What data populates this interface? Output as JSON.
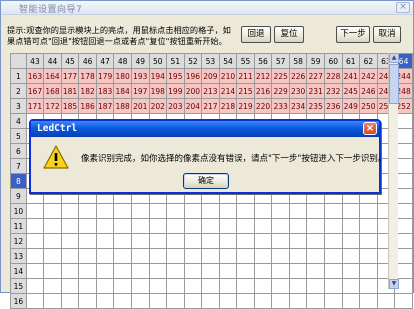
{
  "window": {
    "title": "智能设置向导7",
    "close_glyph": "×"
  },
  "hint_text": "提示:观查你的显示模块上的亮点，用鼠标点击相应的格子，如果点错可点\"回退\"按钮回退一点或者点\"复位\"按钮重新开始。",
  "buttons": {
    "back": "回退",
    "reset": "复位",
    "next": "下一步",
    "cancel": "取消"
  },
  "grid": {
    "columns": [
      "43",
      "44",
      "45",
      "46",
      "47",
      "48",
      "49",
      "50",
      "51",
      "52",
      "53",
      "54",
      "55",
      "56",
      "57",
      "58",
      "59",
      "60",
      "61",
      "62",
      "63",
      "64"
    ],
    "rows": [
      {
        "label": "1",
        "cells": [
          "163",
          "164",
          "177",
          "178",
          "179",
          "180",
          "193",
          "194",
          "195",
          "196",
          "209",
          "210",
          "211",
          "212",
          "225",
          "226",
          "227",
          "228",
          "241",
          "242",
          "243",
          "244"
        ]
      },
      {
        "label": "2",
        "cells": [
          "167",
          "168",
          "181",
          "182",
          "183",
          "184",
          "197",
          "198",
          "199",
          "200",
          "213",
          "214",
          "215",
          "216",
          "229",
          "230",
          "231",
          "232",
          "245",
          "246",
          "247",
          "248"
        ]
      },
      {
        "label": "3",
        "cells": [
          "171",
          "172",
          "185",
          "186",
          "187",
          "188",
          "201",
          "202",
          "203",
          "204",
          "217",
          "218",
          "219",
          "220",
          "233",
          "234",
          "235",
          "236",
          "249",
          "250",
          "251",
          "252"
        ]
      },
      {
        "label": "4",
        "cells": [
          "",
          "",
          "",
          "",
          "",
          "",
          "",
          "",
          "",
          "",
          "",
          "",
          "",
          "",
          "",
          "",
          "",
          "",
          "",
          "",
          "",
          ""
        ]
      },
      {
        "label": "5",
        "cells": [
          "",
          "",
          "",
          "",
          "",
          "",
          "",
          "",
          "",
          "",
          "",
          "",
          "",
          "",
          "",
          "",
          "",
          "",
          "",
          "",
          "",
          ""
        ]
      },
      {
        "label": "6",
        "cells": [
          "",
          "",
          "",
          "",
          "",
          "",
          "",
          "",
          "",
          "",
          "",
          "",
          "",
          "",
          "",
          "",
          "",
          "",
          "",
          "",
          "",
          ""
        ]
      },
      {
        "label": "7",
        "cells": [
          "",
          "",
          "",
          "",
          "",
          "",
          "",
          "",
          "",
          "",
          "",
          "",
          "",
          "",
          "",
          "",
          "",
          "",
          "",
          "",
          "",
          ""
        ]
      },
      {
        "label": "8",
        "cells": [
          "",
          "",
          "",
          "",
          "",
          "",
          "",
          "",
          "",
          "",
          "",
          "",
          "",
          "",
          "",
          "",
          "",
          "",
          "",
          "",
          "",
          ""
        ]
      },
      {
        "label": "9",
        "cells": [
          "",
          "",
          "",
          "",
          "",
          "",
          "",
          "",
          "",
          "",
          "",
          "",
          "",
          "",
          "",
          "",
          "",
          "",
          "",
          "",
          "",
          ""
        ]
      },
      {
        "label": "10",
        "cells": [
          "",
          "",
          "",
          "",
          "",
          "",
          "",
          "",
          "",
          "",
          "",
          "",
          "",
          "",
          "",
          "",
          "",
          "",
          "",
          "",
          "",
          ""
        ]
      },
      {
        "label": "11",
        "cells": [
          "",
          "",
          "",
          "",
          "",
          "",
          "",
          "",
          "",
          "",
          "",
          "",
          "",
          "",
          "",
          "",
          "",
          "",
          "",
          "",
          "",
          ""
        ]
      },
      {
        "label": "12",
        "cells": [
          "",
          "",
          "",
          "",
          "",
          "",
          "",
          "",
          "",
          "",
          "",
          "",
          "",
          "",
          "",
          "",
          "",
          "",
          "",
          "",
          "",
          ""
        ]
      },
      {
        "label": "13",
        "cells": [
          "",
          "",
          "",
          "",
          "",
          "",
          "",
          "",
          "",
          "",
          "",
          "",
          "",
          "",
          "",
          "",
          "",
          "",
          "",
          "",
          "",
          ""
        ]
      },
      {
        "label": "14",
        "cells": [
          "",
          "",
          "",
          "",
          "",
          "",
          "",
          "",
          "",
          "",
          "",
          "",
          "",
          "",
          "",
          "",
          "",
          "",
          "",
          "",
          "",
          ""
        ]
      },
      {
        "label": "15",
        "cells": [
          "",
          "",
          "",
          "",
          "",
          "",
          "",
          "",
          "",
          "",
          "",
          "",
          "",
          "",
          "",
          "",
          "",
          "",
          "",
          "",
          "",
          ""
        ]
      },
      {
        "label": "16",
        "cells": [
          "",
          "",
          "",
          "",
          "",
          "",
          "",
          "",
          "",
          "",
          "",
          "",
          "",
          "",
          "",
          "",
          "",
          "",
          "",
          "",
          "",
          ""
        ]
      }
    ],
    "filled_color": "#f4c7c4",
    "selected_header_color": "#3a60c8"
  },
  "dialog": {
    "title": "LedCtrl",
    "close_glyph": "×",
    "icon": "warning-icon",
    "message": "像素识别完成，如你选择的像素点没有错误，请点\"下一步\"按钮进入下一步识别。",
    "ok_label": "确定"
  }
}
